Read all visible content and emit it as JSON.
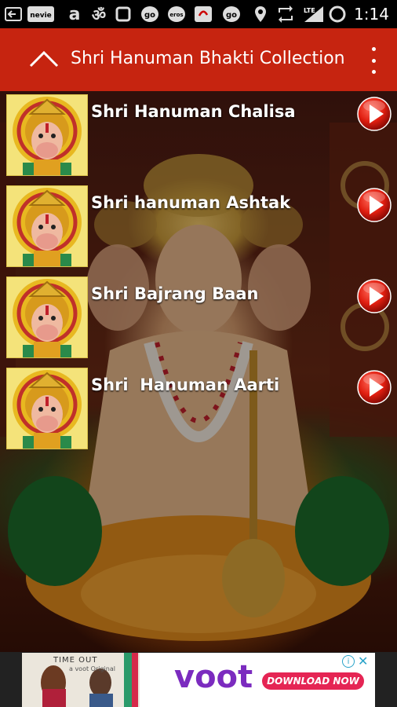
{
  "status_bar": {
    "time": "1:14",
    "icons": [
      "back-arrow-icon",
      "nhs-icon",
      "amazon-icon",
      "om-icon",
      "square-icon",
      "go-icon",
      "eros-icon",
      "airtel-icon",
      "go-icon",
      "location-icon",
      "sync-icon",
      "lte-signal-icon",
      "battery-icon"
    ],
    "network_label": "LTE"
  },
  "app_bar": {
    "title": "Shri Hanuman Bhakti Collection",
    "background": "#c62410"
  },
  "list": {
    "items": [
      {
        "label": "Shri Hanuman Chalisa"
      },
      {
        "label": "Shri hanuman Ashtak"
      },
      {
        "label": "Shri Bajrang Baan"
      },
      {
        "label": "Shri  Hanuman Aarti"
      }
    ]
  },
  "ad": {
    "brand": "voot",
    "cta": "DOWNLOAD NOW",
    "tag": "TIME OUT",
    "subtag": "a voot Original",
    "accent": "#7b2bbf",
    "cta_color": "#e52554"
  }
}
